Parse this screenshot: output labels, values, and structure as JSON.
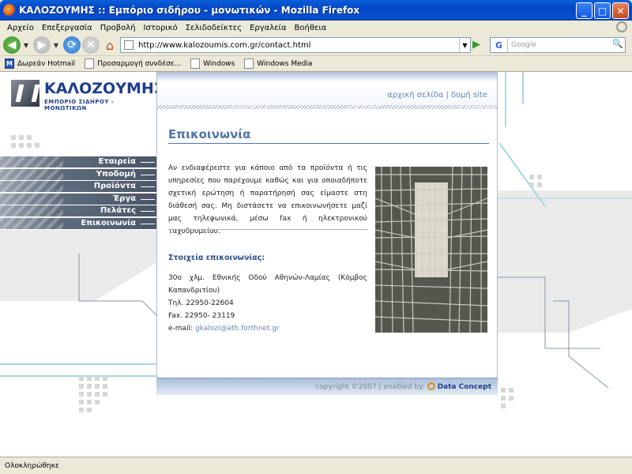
{
  "window": {
    "title": "ΚΑΛΟΖΟΥΜΗΣ :: Εμπόριο σιδήρου - μονωτικών - Mozilla Firefox",
    "minimize": "_",
    "maximize": "□",
    "close": "✕"
  },
  "menu": [
    "Αρχείο",
    "Επεξεργασία",
    "Προβολή",
    "Ιστορικό",
    "Σελιδοδείκτες",
    "Εργαλεία",
    "Βοήθεια"
  ],
  "navbar": {
    "url": "http://www.kalozoumis.com.gr/contact.html",
    "search_placeholder": "Google",
    "search_engine_label": "G"
  },
  "bookmarks": [
    "Δωρεάν Hotmail",
    "Προσαρμογή συνδέσε...",
    "Windows",
    "Windows Media"
  ],
  "site": {
    "logo_name": "ΚΑΛΟΖΟΥΜΗΣ",
    "logo_sub": "ΕΜΠΟΡΙΟ ΣΙΔΗΡΟΥ - ΜΟΝΩΤΙΚΩΝ",
    "top_links": [
      "αρχική σελίδα",
      "δομή site"
    ],
    "top_link_separator": "|",
    "nav": [
      "Εταιρεία",
      "Υποδομή",
      "Προϊόντα",
      "Έργα",
      "Πελάτες",
      "Επικοινωνία"
    ],
    "page_title": "Επικοινωνία",
    "intro": "Αν ενδιαφέρεστε για κάποιο από τα προϊόντα ή τις υπηρεσίες που παρέχουμε καθώς και για οποιαδήποτε σχετική ερώτηση ή παρατήρησή σας είμαστε στη διάθεσή σας. Μη διστάσετε να επικοινωνήσετε μαζί μας τηλεφωνικά, μέσω fax ή ηλεκτρονικού ταχυδρομείου.",
    "contact_heading": "Στοιχεία επικοινωνίας:",
    "address": "30ο χλμ. Εθνικής Οδού Αθηνών-Λαμίας (Κόμβος Καπανδριτίου)",
    "phone": "Τηλ. 22950-22604",
    "fax": "Fax. 22950- 23119",
    "email_label": "e-mail:",
    "email": "gkalozl@ath.forthnet.gr",
    "footer_copyright": "copyright ©2007 | enabled by:",
    "footer_brand": "Data Concept"
  },
  "status": "Ολοκληρώθηκε"
}
